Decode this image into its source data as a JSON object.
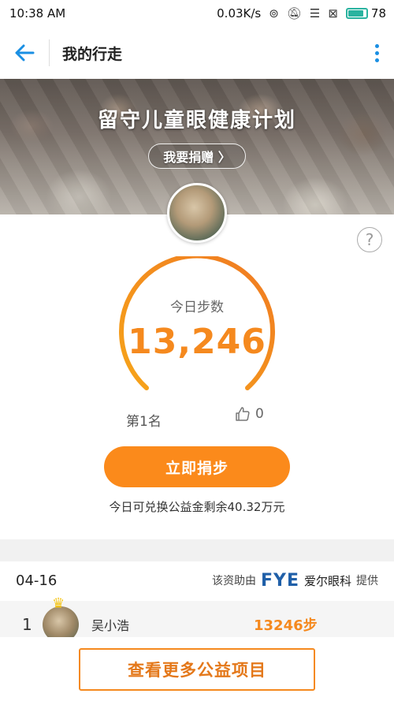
{
  "status_bar": {
    "time": "10:38 AM",
    "speed": "0.03K/s",
    "battery": "78"
  },
  "app_bar": {
    "title": "我的行走"
  },
  "banner": {
    "title": "留守儿童眼健康计划",
    "donate_label": "我要捐赠 〉"
  },
  "steps": {
    "label": "今日步数",
    "value": "13,246",
    "rank": "第1名",
    "likes": "0",
    "donate_button": "立即捐步",
    "remaining_text": "今日可兑换公益金剩余40.32万元"
  },
  "ranking": {
    "date": "04-16",
    "sponsor_prefix": "该资助由",
    "sponsor_logo": "FYE",
    "sponsor_name": "爱尔眼科",
    "sponsor_suffix": "提供",
    "rows": [
      {
        "rank": "1",
        "name": "吴小浩",
        "steps": "13246步"
      }
    ]
  },
  "footer": {
    "more_projects": "查看更多公益项目"
  },
  "colors": {
    "accent": "#f5891e",
    "button": "#fb8a1b",
    "link_blue": "#1a8fe3"
  }
}
